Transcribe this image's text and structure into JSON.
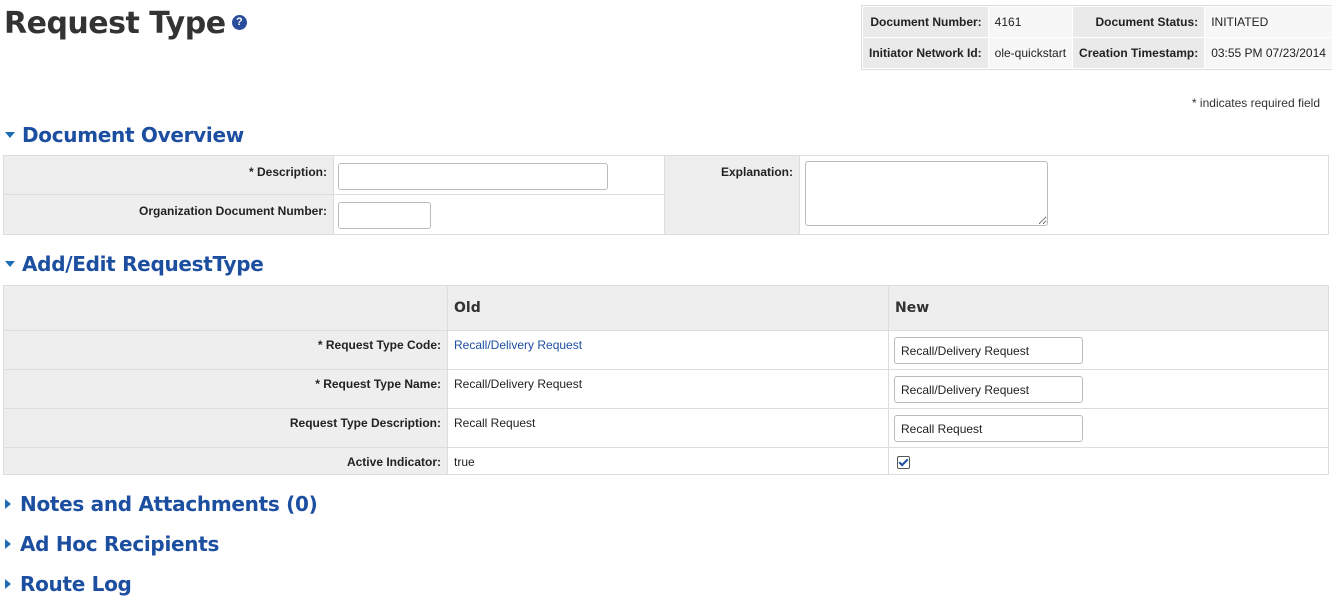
{
  "page": {
    "title": "Request Type",
    "help_icon": "question-circle-icon"
  },
  "header": {
    "doc_number_label": "Document Number:",
    "doc_number": "4161",
    "doc_status_label": "Document Status:",
    "doc_status": "INITIATED",
    "initiator_label": "Initiator Network Id:",
    "initiator": "ole-quickstart",
    "created_label": "Creation Timestamp:",
    "created": "03:55 PM 07/23/2014"
  },
  "required_note": "* indicates required field",
  "overview": {
    "title": "Document Overview",
    "description_label": "* Description:",
    "description_value": "",
    "org_doc_number_label": "Organization Document Number:",
    "org_doc_number_value": "",
    "explanation_label": "Explanation:",
    "explanation_value": ""
  },
  "edit": {
    "title": "Add/Edit RequestType",
    "old_header": "Old",
    "new_header": "New",
    "rows": [
      {
        "label": "* Request Type Code:",
        "old": "Recall/Delivery Request",
        "new": "Recall/Delivery Request"
      },
      {
        "label": "* Request Type Name:",
        "old": "Recall/Delivery Request",
        "new": "Recall/Delivery Request"
      },
      {
        "label": "Request Type Description:",
        "old": "Recall Request",
        "new": "Recall Request"
      },
      {
        "label": "Active Indicator:",
        "old": "true",
        "new_checked": true
      }
    ]
  },
  "collapsed_sections": {
    "notes": "Notes and Attachments (0)",
    "adhoc": "Ad Hoc Recipients",
    "route_log": "Route Log"
  },
  "colors": {
    "section_title": "#1d4fa0",
    "link": "#1d4fa0",
    "label_bg": "#eeeeee"
  }
}
